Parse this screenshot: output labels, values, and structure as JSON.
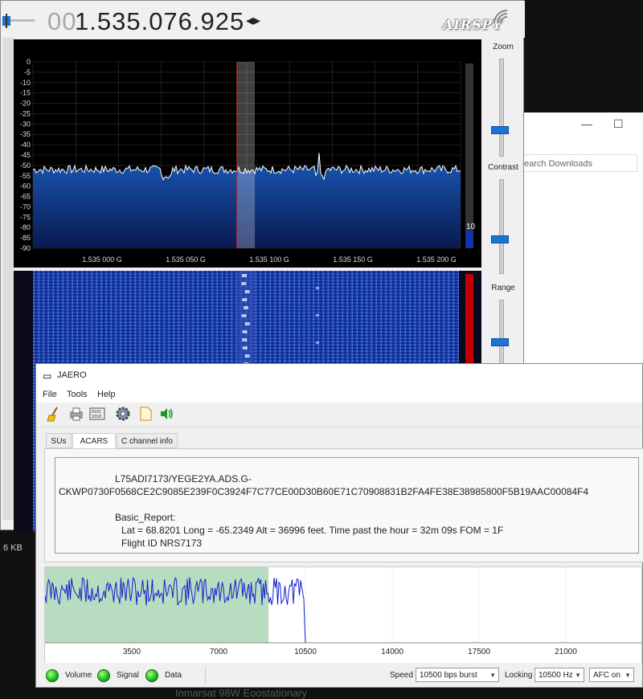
{
  "colors": {
    "spectrum_fill": "#0a3a8a",
    "spectrum_line": "#ffffff",
    "marker": "#ff2020",
    "scope_line": "#1020d0",
    "scope_band": "#b8dcc0",
    "led_green": "#22c022"
  },
  "sdr": {
    "freq_dim": "00",
    "freq_main": "1.535.076.925",
    "freq_arrows": "◂▸",
    "logo": "AIRSPY",
    "panel": {
      "zoom": "Zoom",
      "contrast": "Contrast",
      "range": "Range",
      "level": "10"
    },
    "spectrum": {
      "y_ticks": [
        "0",
        "-5",
        "-10",
        "-15",
        "-20",
        "-25",
        "-30",
        "-35",
        "-40",
        "-45",
        "-50",
        "-55",
        "-60",
        "-65",
        "-70",
        "-75",
        "-80",
        "-85",
        "-90"
      ],
      "x_ticks": [
        "1.535 000 G",
        "1.535 050 G",
        "1.535 100 G",
        "1.535 150 G",
        "1.535 200 G"
      ]
    }
  },
  "downloads": {
    "search_placeholder": "earch Downloads",
    "minimize": "—",
    "maximize": "☐",
    "size_text": "6 KB"
  },
  "jaero": {
    "title": "JAERO",
    "menu": [
      "File",
      "Tools",
      "Help"
    ],
    "toolbar_icons": [
      "broom-icon",
      "printer-icon",
      "binary-icon",
      "gear-icon",
      "document-icon",
      "speaker-icon"
    ],
    "tabs": [
      "SUs",
      "ACARS",
      "C channel info"
    ],
    "active_tab": "ACARS",
    "acars": {
      "line1": "L75ADI7173/YEGE2YA.ADS.G-",
      "line2": "CKWP0730F0568CE2C9085E239F0C3924F7C77CE00D30B60E71C70908831B2FA4FE38E38985800F5B19AAC00084F4",
      "line3": "Basic_Report:",
      "line4": "Lat = 68.8201 Long = -65.2349 Alt = 36996 feet. Time past the hour = 32m 09s FOM = 1F",
      "line5": "Flight ID NRS7173"
    },
    "scope": {
      "x_ticks": [
        "3500",
        "7000",
        "10500",
        "14000",
        "17500",
        "21000"
      ]
    },
    "status": {
      "indicators": [
        "Volume",
        "Signal",
        "Data"
      ],
      "speed_label": "Speed",
      "speed_value": "10500 bps burst",
      "locking_label": "Locking",
      "locking_value": "10500 Hz",
      "afc_value": "AFC on"
    }
  },
  "caption": "Inmarsat 98W Eoostationary"
}
